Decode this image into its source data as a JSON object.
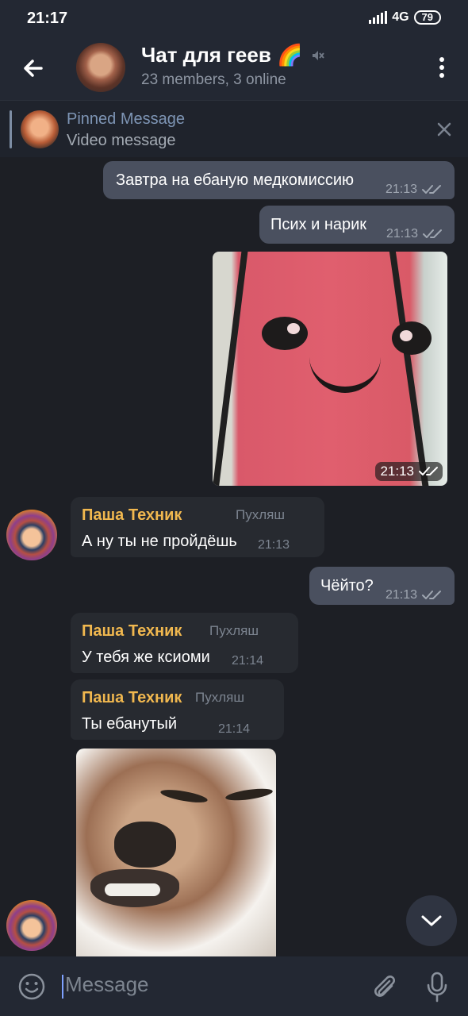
{
  "status_bar": {
    "time": "21:17",
    "network": "4G",
    "battery": "79"
  },
  "header": {
    "title": "Чат для геев 🌈",
    "subtitle": "23 members, 3 online",
    "avatar_icon": "profile-photo"
  },
  "pinned": {
    "title": "Pinned Message",
    "subtitle": "Video message"
  },
  "messages": [
    {
      "type": "outgoing",
      "text": "Завтра на ебаную медкомиссию",
      "time": "21:13"
    },
    {
      "type": "outgoing",
      "text": "Псих и нарик",
      "time": "21:13"
    },
    {
      "type": "outgoing_image",
      "time": "21:13"
    },
    {
      "type": "incoming",
      "sender": "Паша Техник",
      "rank": "Пухляш",
      "text": "А ну ты не пройдёшь",
      "time": "21:13"
    },
    {
      "type": "outgoing",
      "text": "Чёйто?",
      "time": "21:13"
    },
    {
      "type": "incoming",
      "sender": "Паша Техник",
      "rank": "Пухляш",
      "text": "У тебя же ксиоми",
      "time": "21:14"
    },
    {
      "type": "incoming",
      "sender": "Паша Техник",
      "rank": "Пухляш",
      "text": "Ты ебанутый",
      "time": "21:14"
    },
    {
      "type": "incoming_sticker"
    }
  ],
  "composer": {
    "placeholder": "Message"
  },
  "colors": {
    "background": "#1d1f25",
    "header": "#232833",
    "outgoing_bubble": "#4a505f",
    "incoming_bubble": "#272a30",
    "sender_name": "#f1b84f",
    "pinned_title": "#7e95b5"
  }
}
